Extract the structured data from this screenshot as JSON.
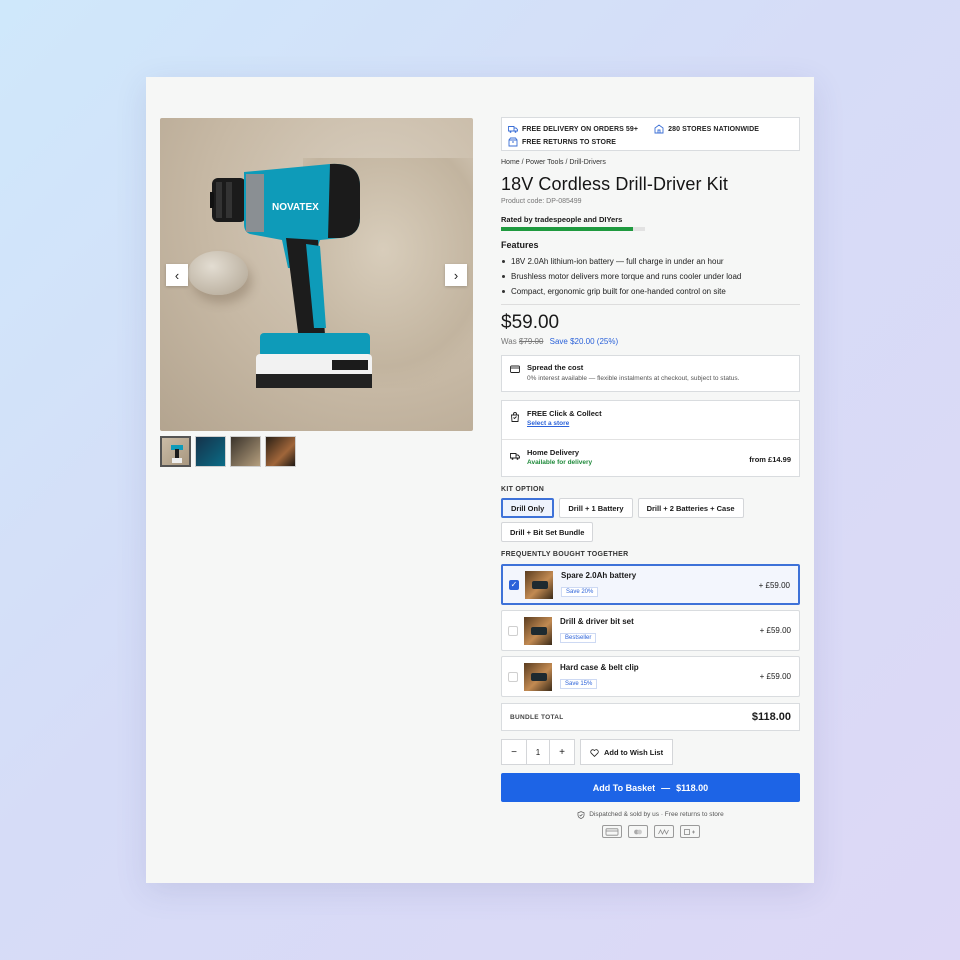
{
  "promo": {
    "delivery": "FREE DELIVERY ON ORDERS 59+",
    "stores": "280 STORES NATIONWIDE",
    "returns": "FREE RETURNS TO STORE"
  },
  "breadcrumb": "Home / Power Tools / Drill-Drivers",
  "product": {
    "title": "18V Cordless Drill-Driver Kit",
    "code": "Product code: DP-085499",
    "rated": "Rated by tradespeople and DIYers",
    "rating_fraction": 0.92,
    "brand_on_image": "NOVATEX"
  },
  "features": {
    "heading": "Features",
    "items": [
      "18V 2.0Ah lithium-ion battery — full charge in under an hour",
      "Brushless motor delivers more torque and runs cooler under load",
      "Compact, ergonomic grip built for one-handed control on site"
    ]
  },
  "pricing": {
    "price": "$59.00",
    "was_label": "Was",
    "was_price": "$79.00",
    "save": "Save $20.00 (25%)"
  },
  "spread": {
    "title": "Spread the cost",
    "text": "0% interest available — flexible instalments at checkout, subject to status."
  },
  "fulfilment": {
    "collect_title": "FREE Click & Collect",
    "collect_link": "Select a store",
    "delivery_title": "Home Delivery",
    "delivery_status": "Available for delivery",
    "delivery_price": "from £14.99"
  },
  "kit": {
    "label": "KIT OPTION",
    "options": [
      "Drill Only",
      "Drill + 1 Battery",
      "Drill + 2 Batteries + Case",
      "Drill + Bit Set Bundle"
    ],
    "selected": "Drill Only"
  },
  "fbt": {
    "label": "FREQUENTLY BOUGHT TOGETHER",
    "items": [
      {
        "name": "Spare 2.0Ah battery",
        "badge": "Save 20%",
        "price": "+ £59.00",
        "checked": true
      },
      {
        "name": "Drill & driver bit set",
        "badge": "Bestseller",
        "price": "+ £59.00",
        "checked": false
      },
      {
        "name": "Hard case & belt clip",
        "badge": "Save 15%",
        "price": "+ £59.00",
        "checked": false
      }
    ]
  },
  "bundle": {
    "label": "BUNDLE TOTAL",
    "total": "$118.00"
  },
  "quantity": {
    "minus": "−",
    "value": "1",
    "plus": "+"
  },
  "wishlist": "Add to Wish List",
  "cta": {
    "label": "Add To Basket",
    "sep": "—",
    "price": "$118.00"
  },
  "dispatch": "Dispatched & sold by us · Free returns to store",
  "payments": [
    "card-icon",
    "mastercard-icon",
    "wallet-icon",
    "giftcard-icon"
  ],
  "colors": {
    "accent": "#1d64e6",
    "rating": "#1f9a3f",
    "link": "#2b62d9"
  }
}
